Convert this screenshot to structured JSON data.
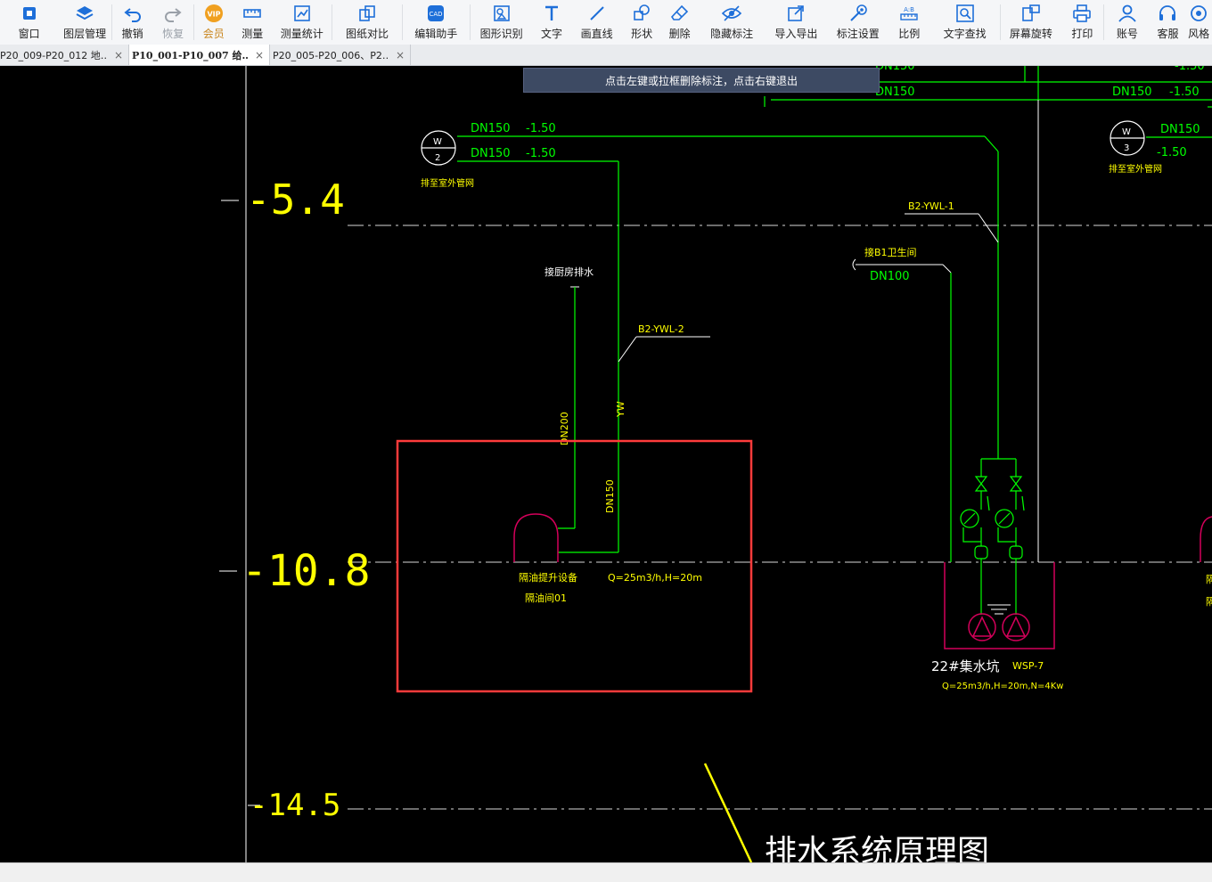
{
  "toolbar": {
    "items": [
      {
        "label": "窗口",
        "icon": "window-icon"
      },
      {
        "label": "图层管理",
        "icon": "layers-icon"
      },
      {
        "label": "撤销",
        "icon": "undo-icon"
      },
      {
        "label": "恢复",
        "icon": "redo-icon"
      },
      {
        "label": "会员",
        "icon": "vip-icon"
      },
      {
        "label": "测量",
        "icon": "ruler-icon"
      },
      {
        "label": "测量统计",
        "icon": "measure-stats-icon"
      },
      {
        "label": "图纸对比",
        "icon": "compare-icon"
      },
      {
        "label": "编辑助手",
        "icon": "edit-assistant-icon"
      },
      {
        "label": "图形识别",
        "icon": "shape-recognition-icon"
      },
      {
        "label": "文字",
        "icon": "text-icon"
      },
      {
        "label": "画直线",
        "icon": "line-icon"
      },
      {
        "label": "形状",
        "icon": "shape-icon"
      },
      {
        "label": "删除",
        "icon": "eraser-icon"
      },
      {
        "label": "隐藏标注",
        "icon": "eye-hide-icon"
      },
      {
        "label": "导入导出",
        "icon": "import-export-icon"
      },
      {
        "label": "标注设置",
        "icon": "annotation-settings-icon"
      },
      {
        "label": "比例",
        "icon": "scale-icon"
      },
      {
        "label": "文字查找",
        "icon": "text-search-icon"
      },
      {
        "label": "屏幕旋转",
        "icon": "screen-rotate-icon"
      },
      {
        "label": "打印",
        "icon": "printer-icon"
      },
      {
        "label": "账号",
        "icon": "user-icon"
      },
      {
        "label": "客服",
        "icon": "headset-icon"
      },
      {
        "label": "风格",
        "icon": "style-icon"
      }
    ],
    "accent_color": "#1e6fd9"
  },
  "tabs": [
    {
      "label": "P20_009-P20_012 地…",
      "active": false
    },
    {
      "label": "P10_001-P10_007 给…",
      "active": true
    },
    {
      "label": "P20_005-P20_006、P2…",
      "active": false
    }
  ],
  "tab_close_glyph": "×",
  "hint": {
    "text": "点击左键或拉框删除标注，点击右键退出"
  },
  "drawing": {
    "level_labels": [
      "-5.4",
      "-10.8",
      "-14.5"
    ],
    "title": "排水系统原理图",
    "top_cut_1": "DN150",
    "top_cut_2": "-1.50",
    "top_dn_left": "DN150",
    "top_dn_right": "DN150",
    "top_val_right": "-1.50",
    "line_a_dn": "DN150",
    "line_a_val": "-1.50",
    "line_b_dn": "DN150",
    "line_b_val": "-1.50",
    "w2_letter": "W",
    "w2_num": "2",
    "w2_caption": "排至室外管网",
    "w3_letter": "W",
    "w3_num": "3",
    "w3_caption": "排至室外管网",
    "w3_dn": "DN150",
    "w3_val": "-1.50",
    "ywl1": "B2-YWL-1",
    "b1_label": "接B1卫生间",
    "b1_dn": "DN100",
    "kitchen_label": "接厨房排水",
    "ywl2": "B2-YWL-2",
    "dn200_v": "DN200",
    "yw_v": "YW",
    "dn150_v": "DN150",
    "device_name": "隔油提升设备",
    "device_room": "隔油间01",
    "device_spec": "Q=25m3/h,H=20m",
    "sump_name": "22#集水坑",
    "sump_code": "WSP-7",
    "sump_spec": "Q=25m3/h,H=20m,N=4Kw",
    "right_cut_1": "隔",
    "right_cut_2": "隔"
  },
  "colors": {
    "background": "#000000",
    "pipe": "#00ff00",
    "text_yellow": "#ffff00",
    "text_white": "#ffffff",
    "equipment": "#d4005a",
    "selection": "#ff3b3b"
  }
}
